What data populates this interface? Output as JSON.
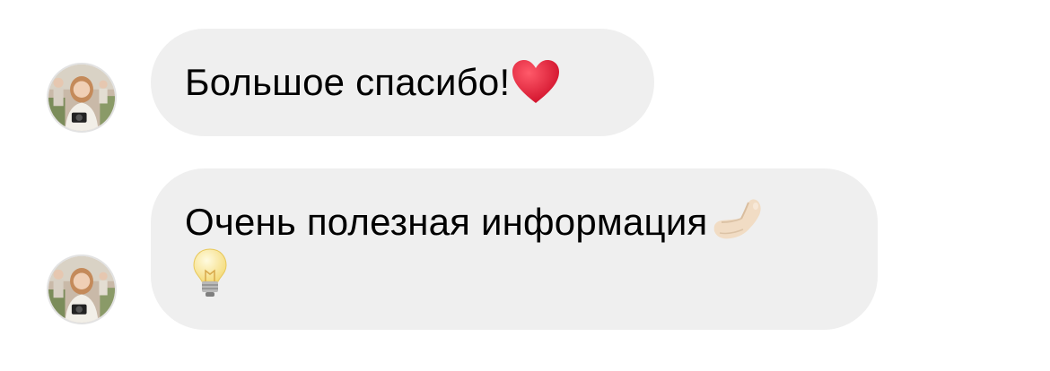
{
  "thread": {
    "messages": [
      {
        "sender": "incoming",
        "text": "Большое спасибо!",
        "emojis": [
          "heart-emoji"
        ]
      },
      {
        "sender": "incoming",
        "text": "Очень полезная информация",
        "emojis": [
          "pinched-fingers-emoji",
          "light-bulb-emoji"
        ]
      }
    ]
  },
  "colors": {
    "bubble_background": "#efefef",
    "avatar_border": "#e2e2e2",
    "heart": "#e0203a"
  }
}
